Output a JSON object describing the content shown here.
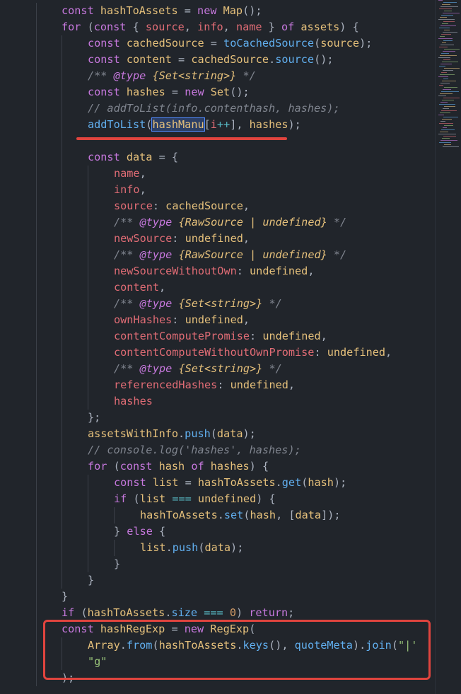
{
  "editor": {
    "language": "javascript",
    "theme_colors": {
      "background": "#21252b",
      "keyword": "#c678dd",
      "function": "#61afef",
      "property": "#e06c75",
      "comment": "#7f848e",
      "string": "#98c379",
      "number": "#d19a66",
      "operator": "#56b6c2",
      "class": "#e5c07b",
      "plain": "#abb2bf",
      "annotation": "#e0443e"
    },
    "lines": [
      [
        [
          "kw",
          "const "
        ],
        [
          "ident",
          "hashToAssets"
        ],
        [
          "plain",
          " = "
        ],
        [
          "kw",
          "new "
        ],
        [
          "cls",
          "Map"
        ],
        [
          "plain",
          "();"
        ]
      ],
      [
        [
          "kw",
          "for "
        ],
        [
          "plain",
          "("
        ],
        [
          "kw",
          "const "
        ],
        [
          "plain",
          "{ "
        ],
        [
          "var",
          "source"
        ],
        [
          "plain",
          ", "
        ],
        [
          "var",
          "info"
        ],
        [
          "plain",
          ", "
        ],
        [
          "var",
          "name"
        ],
        [
          "plain",
          " } "
        ],
        [
          "kw",
          "of "
        ],
        [
          "ident",
          "assets"
        ],
        [
          "plain",
          ") {"
        ]
      ],
      [
        [
          "kw",
          "const "
        ],
        [
          "ident",
          "cachedSource"
        ],
        [
          "plain",
          " = "
        ],
        [
          "fn",
          "toCachedSource"
        ],
        [
          "plain",
          "("
        ],
        [
          "ident",
          "source"
        ],
        [
          "plain",
          ");"
        ]
      ],
      [
        [
          "kw",
          "const "
        ],
        [
          "ident",
          "content"
        ],
        [
          "plain",
          " = "
        ],
        [
          "ident",
          "cachedSource"
        ],
        [
          "plain",
          "."
        ],
        [
          "fn",
          "source"
        ],
        [
          "plain",
          "();"
        ]
      ],
      [
        [
          "cmt",
          "/** "
        ],
        [
          "tag",
          "@type "
        ],
        [
          "type",
          "{Set<string>}"
        ],
        [
          "cmt",
          " */"
        ]
      ],
      [
        [
          "kw",
          "const "
        ],
        [
          "ident",
          "hashes"
        ],
        [
          "plain",
          " = "
        ],
        [
          "kw",
          "new "
        ],
        [
          "cls",
          "Set"
        ],
        [
          "plain",
          "();"
        ]
      ],
      [
        [
          "cmt",
          "// addToList(info.contenthash, hashes);"
        ]
      ],
      [
        [
          "fn",
          "addToList"
        ],
        [
          "plain",
          "("
        ],
        [
          "sel",
          "hashManu"
        ],
        [
          "plain",
          "["
        ],
        [
          "var",
          "i"
        ],
        [
          "op",
          "++"
        ],
        [
          "plain",
          "], "
        ],
        [
          "ident",
          "hashes"
        ],
        [
          "plain",
          ");"
        ]
      ],
      [],
      [
        [
          "kw",
          "const "
        ],
        [
          "ident",
          "data"
        ],
        [
          "plain",
          " = {"
        ]
      ],
      [
        [
          "prop",
          "name"
        ],
        [
          "plain",
          ","
        ]
      ],
      [
        [
          "prop",
          "info"
        ],
        [
          "plain",
          ","
        ]
      ],
      [
        [
          "prop",
          "source"
        ],
        [
          "plain",
          ": "
        ],
        [
          "ident",
          "cachedSource"
        ],
        [
          "plain",
          ","
        ]
      ],
      [
        [
          "cmt",
          "/** "
        ],
        [
          "tag",
          "@type "
        ],
        [
          "type",
          "{RawSource | undefined}"
        ],
        [
          "cmt",
          " */"
        ]
      ],
      [
        [
          "prop",
          "newSource"
        ],
        [
          "plain",
          ": "
        ],
        [
          "ident",
          "undefined"
        ],
        [
          "plain",
          ","
        ]
      ],
      [
        [
          "cmt",
          "/** "
        ],
        [
          "tag",
          "@type "
        ],
        [
          "type",
          "{RawSource | undefined}"
        ],
        [
          "cmt",
          " */"
        ]
      ],
      [
        [
          "prop",
          "newSourceWithoutOwn"
        ],
        [
          "plain",
          ": "
        ],
        [
          "ident",
          "undefined"
        ],
        [
          "plain",
          ","
        ]
      ],
      [
        [
          "prop",
          "content"
        ],
        [
          "plain",
          ","
        ]
      ],
      [
        [
          "cmt",
          "/** "
        ],
        [
          "tag",
          "@type "
        ],
        [
          "type",
          "{Set<string>}"
        ],
        [
          "cmt",
          " */"
        ]
      ],
      [
        [
          "prop",
          "ownHashes"
        ],
        [
          "plain",
          ": "
        ],
        [
          "ident",
          "undefined"
        ],
        [
          "plain",
          ","
        ]
      ],
      [
        [
          "prop",
          "contentComputePromise"
        ],
        [
          "plain",
          ": "
        ],
        [
          "ident",
          "undefined"
        ],
        [
          "plain",
          ","
        ]
      ],
      [
        [
          "prop",
          "contentComputeWithoutOwnPromise"
        ],
        [
          "plain",
          ": "
        ],
        [
          "ident",
          "undefined"
        ],
        [
          "plain",
          ","
        ]
      ],
      [
        [
          "cmt",
          "/** "
        ],
        [
          "tag",
          "@type "
        ],
        [
          "type",
          "{Set<string>}"
        ],
        [
          "cmt",
          " */"
        ]
      ],
      [
        [
          "prop",
          "referencedHashes"
        ],
        [
          "plain",
          ": "
        ],
        [
          "ident",
          "undefined"
        ],
        [
          "plain",
          ","
        ]
      ],
      [
        [
          "prop",
          "hashes"
        ]
      ],
      [
        [
          "plain",
          "};"
        ]
      ],
      [
        [
          "ident",
          "assetsWithInfo"
        ],
        [
          "plain",
          "."
        ],
        [
          "fn",
          "push"
        ],
        [
          "plain",
          "("
        ],
        [
          "ident",
          "data"
        ],
        [
          "plain",
          ");"
        ]
      ],
      [
        [
          "cmt",
          "// console.log('hashes', hashes);"
        ]
      ],
      [
        [
          "kw",
          "for "
        ],
        [
          "plain",
          "("
        ],
        [
          "kw",
          "const "
        ],
        [
          "ident",
          "hash"
        ],
        [
          "plain",
          " "
        ],
        [
          "kw",
          "of "
        ],
        [
          "ident",
          "hashes"
        ],
        [
          "plain",
          ") {"
        ]
      ],
      [
        [
          "kw",
          "const "
        ],
        [
          "ident",
          "list"
        ],
        [
          "plain",
          " = "
        ],
        [
          "ident",
          "hashToAssets"
        ],
        [
          "plain",
          "."
        ],
        [
          "fn",
          "get"
        ],
        [
          "plain",
          "("
        ],
        [
          "ident",
          "hash"
        ],
        [
          "plain",
          ");"
        ]
      ],
      [
        [
          "kw",
          "if "
        ],
        [
          "plain",
          "("
        ],
        [
          "ident",
          "list"
        ],
        [
          "plain",
          " "
        ],
        [
          "op",
          "==="
        ],
        [
          "plain",
          " "
        ],
        [
          "ident",
          "undefined"
        ],
        [
          "plain",
          ") {"
        ]
      ],
      [
        [
          "ident",
          "hashToAssets"
        ],
        [
          "plain",
          "."
        ],
        [
          "fn",
          "set"
        ],
        [
          "plain",
          "("
        ],
        [
          "ident",
          "hash"
        ],
        [
          "plain",
          ", ["
        ],
        [
          "ident",
          "data"
        ],
        [
          "plain",
          "]);"
        ]
      ],
      [
        [
          "plain",
          "} "
        ],
        [
          "kw",
          "else "
        ],
        [
          "plain",
          "{"
        ]
      ],
      [
        [
          "ident",
          "list"
        ],
        [
          "plain",
          "."
        ],
        [
          "fn",
          "push"
        ],
        [
          "plain",
          "("
        ],
        [
          "ident",
          "data"
        ],
        [
          "plain",
          ");"
        ]
      ],
      [
        [
          "plain",
          "}"
        ]
      ],
      [
        [
          "plain",
          "}"
        ]
      ],
      [
        [
          "plain",
          "}"
        ]
      ],
      [
        [
          "kw",
          "if "
        ],
        [
          "plain",
          "("
        ],
        [
          "ident",
          "hashToAssets"
        ],
        [
          "plain",
          "."
        ],
        [
          "fn",
          "size"
        ],
        [
          "plain",
          " "
        ],
        [
          "op",
          "==="
        ],
        [
          "plain",
          " "
        ],
        [
          "num",
          "0"
        ],
        [
          "plain",
          ") "
        ],
        [
          "kw",
          "return"
        ],
        [
          "plain",
          ";"
        ]
      ],
      [
        [
          "kw",
          "const "
        ],
        [
          "ident",
          "hashRegExp"
        ],
        [
          "plain",
          " = "
        ],
        [
          "kw",
          "new "
        ],
        [
          "cls",
          "RegExp"
        ],
        [
          "plain",
          "("
        ]
      ],
      [
        [
          "cls",
          "Array"
        ],
        [
          "plain",
          "."
        ],
        [
          "fn",
          "from"
        ],
        [
          "plain",
          "("
        ],
        [
          "ident",
          "hashToAssets"
        ],
        [
          "plain",
          "."
        ],
        [
          "fn",
          "keys"
        ],
        [
          "plain",
          "(), "
        ],
        [
          "fn",
          "quoteMeta"
        ],
        [
          "plain",
          ")."
        ],
        [
          "fn",
          "join"
        ],
        [
          "plain",
          "("
        ],
        [
          "str",
          "\"|'"
        ]
      ],
      [
        [
          "str",
          "\"g\""
        ]
      ],
      [
        [
          "plain",
          ");"
        ]
      ]
    ]
  }
}
